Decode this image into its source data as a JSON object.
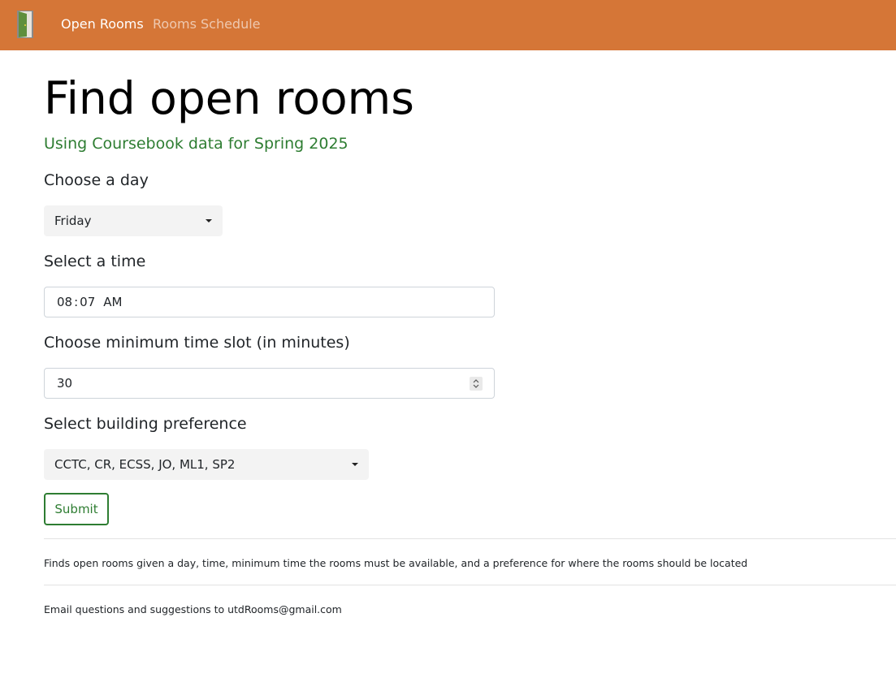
{
  "navbar": {
    "brand_icon": "door-icon",
    "links": [
      "Open Rooms",
      "Rooms Schedule"
    ],
    "colors": {
      "background": "#d57637"
    }
  },
  "page": {
    "title": "Find open rooms",
    "subtitle": "Using Coursebook data for Spring 2025"
  },
  "form": {
    "day_label": "Choose a day",
    "day_value": "Friday",
    "time_label": "Select a time",
    "time_hour": "08",
    "time_sep": ":",
    "time_minute": "07",
    "time_period": "AM",
    "slot_label": "Choose minimum time slot (in minutes)",
    "slot_value": "30",
    "building_label": "Select building preference",
    "building_value": "CCTC, CR, ECSS, JO, ML1, SP2",
    "submit_label": "Submit"
  },
  "footer": {
    "description": "Finds open rooms given a day, time, minimum time the rooms must be available, and a preference for where the rooms should be located",
    "contact": "Email questions and suggestions to utdRooms@gmail.com"
  }
}
